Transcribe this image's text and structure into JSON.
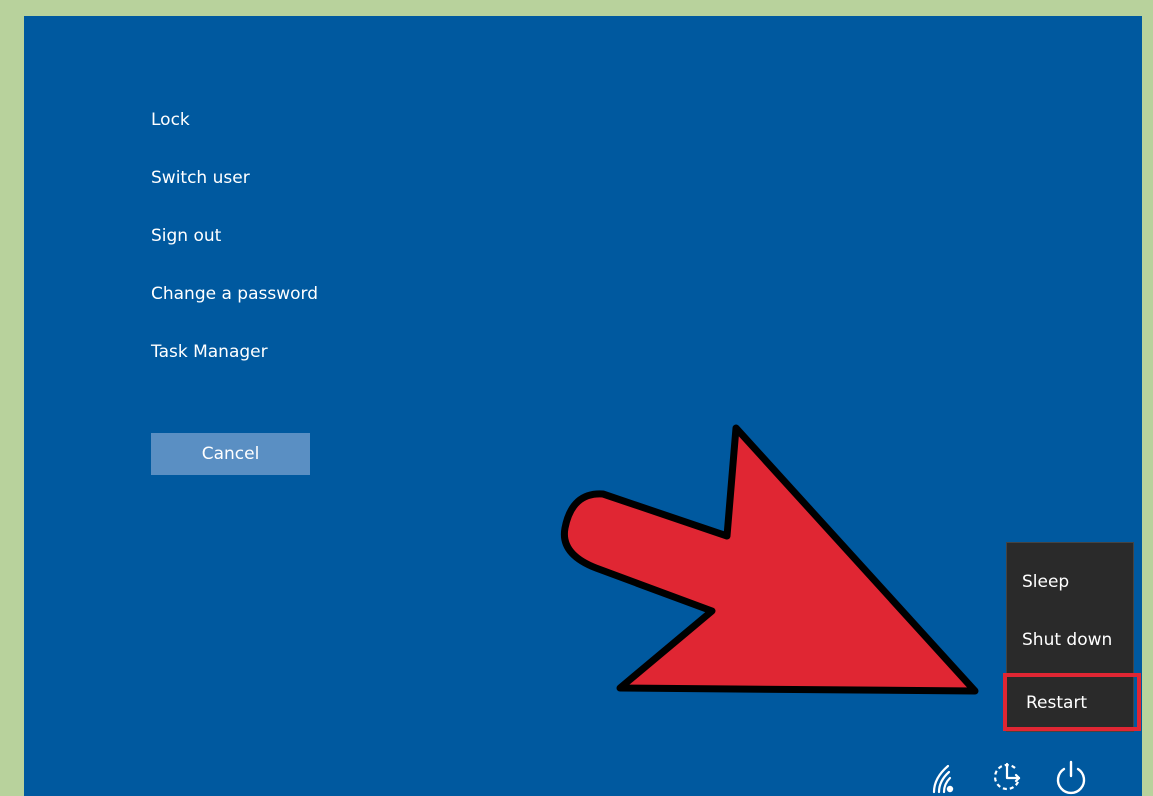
{
  "menu": {
    "items": [
      {
        "label": "Lock"
      },
      {
        "label": "Switch user"
      },
      {
        "label": "Sign out"
      },
      {
        "label": "Change a password"
      },
      {
        "label": "Task Manager"
      }
    ],
    "cancel_label": "Cancel"
  },
  "power_menu": {
    "sleep_label": "Sleep",
    "shutdown_label": "Shut down",
    "restart_label": "Restart"
  },
  "system_icons": [
    "wifi-icon",
    "ease-of-access-icon",
    "power-icon"
  ],
  "colors": {
    "background": "#00599f",
    "frame": "#b8d29c",
    "arrow": "#e02633",
    "highlight": "#e02633",
    "menu_bg": "#2a2a2a",
    "cancel_bg": "#5a8fc3"
  }
}
